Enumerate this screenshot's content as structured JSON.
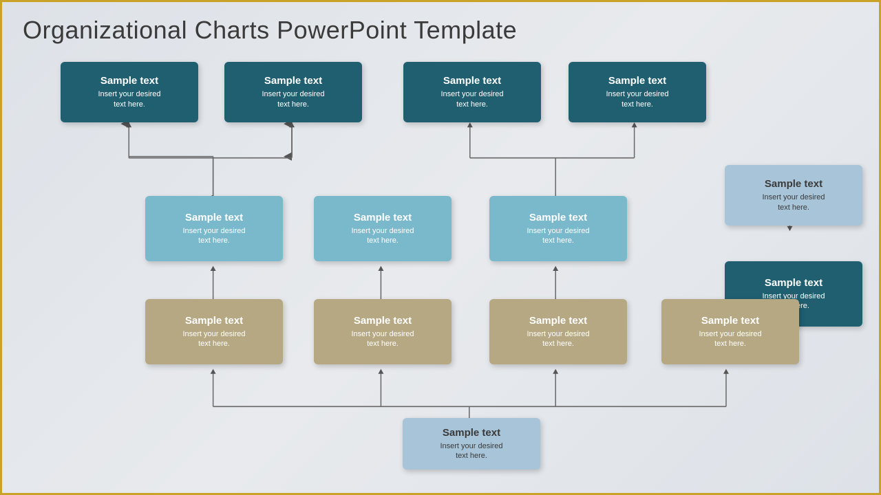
{
  "title": "Organizational Charts PowerPoint Template",
  "boxes": {
    "row1": [
      {
        "id": "r1b1",
        "title": "Sample text",
        "sub": "Insert your desired\ntext here."
      },
      {
        "id": "r1b2",
        "title": "Sample text",
        "sub": "Insert your desired\ntext here."
      },
      {
        "id": "r1b3",
        "title": "Sample text",
        "sub": "Insert your desired\ntext here."
      },
      {
        "id": "r1b4",
        "title": "Sample text",
        "sub": "Insert your desired\ntext here."
      }
    ],
    "row2": [
      {
        "id": "r2b1",
        "title": "Sample text",
        "sub": "Insert your desired\ntext here."
      },
      {
        "id": "r2b2",
        "title": "Sample text",
        "sub": "Insert your desired\ntext here."
      },
      {
        "id": "r2b3",
        "title": "Sample text",
        "sub": "Insert your desired\ntext here."
      }
    ],
    "row3": [
      {
        "id": "r3b1",
        "title": "Sample text",
        "sub": "Insert your desired\ntext here."
      },
      {
        "id": "r3b2",
        "title": "Sample text",
        "sub": "Insert your desired\ntext here."
      },
      {
        "id": "r3b3",
        "title": "Sample text",
        "sub": "Insert your desired\ntext here."
      },
      {
        "id": "r3b4",
        "title": "Sample text",
        "sub": "Insert your desired\ntext here."
      }
    ],
    "right_top": {
      "title": "Sample text",
      "sub": "Insert your desired\ntext here."
    },
    "right_mid": {
      "title": "Sample text",
      "sub": "Insert your desired\ntext here."
    },
    "bottom": {
      "title": "Sample text",
      "sub": "Insert your desired\ntext here."
    }
  }
}
